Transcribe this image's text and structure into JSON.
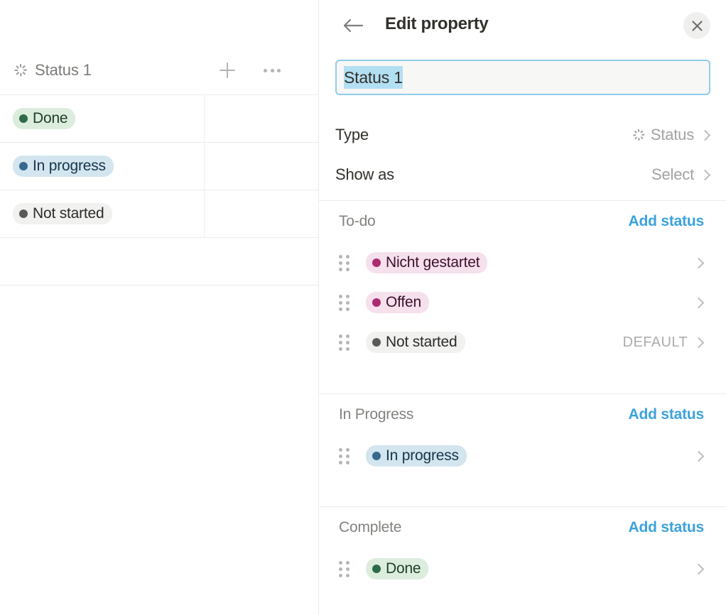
{
  "table": {
    "column": {
      "title": "Status 1",
      "icon": "status-spinner-icon",
      "add_column_icon": "plus-icon",
      "menu_icon": "ellipsis-icon"
    },
    "rows": [
      {
        "label": "Done",
        "bg": "#dcedde",
        "dot": "#2e6b48",
        "fg": "#1d3d2a"
      },
      {
        "label": "In progress",
        "bg": "#d3e5ef",
        "dot": "#37698f",
        "fg": "#17354b"
      },
      {
        "label": "Not started",
        "bg": "#f1f1ef",
        "dot": "#5a5a57",
        "fg": "#2b2b29"
      }
    ],
    "empty_row": ""
  },
  "panel": {
    "title": "Edit property",
    "back_icon": "arrow-left-icon",
    "close_icon": "close-icon",
    "name_value": "Status 1",
    "options": [
      {
        "label": "Type",
        "value": "Status",
        "has_icon": true
      },
      {
        "label": "Show as",
        "value": "Select",
        "has_icon": false
      }
    ],
    "add_status_label": "Add status",
    "default_tag": "DEFAULT",
    "groups": [
      {
        "name": "To-do",
        "statuses": [
          {
            "label": "Nicht gestartet",
            "bg": "#f5e0ec",
            "dot": "#ad2a72",
            "fg": "#3d1029",
            "default": false
          },
          {
            "label": "Offen",
            "bg": "#f5e0ec",
            "dot": "#ad2a72",
            "fg": "#3d1029",
            "default": false
          },
          {
            "label": "Not started",
            "bg": "#f1f1ef",
            "dot": "#5a5a57",
            "fg": "#2b2b29",
            "default": true
          }
        ]
      },
      {
        "name": "In Progress",
        "statuses": [
          {
            "label": "In progress",
            "bg": "#d3e5ef",
            "dot": "#37698f",
            "fg": "#17354b",
            "default": false
          }
        ]
      },
      {
        "name": "Complete",
        "statuses": [
          {
            "label": "Done",
            "bg": "#dcedde",
            "dot": "#2e6b48",
            "fg": "#1d3d2a",
            "default": false
          }
        ]
      }
    ]
  },
  "colors": {
    "accent_link": "#3ba2de",
    "input_border": "#8fcdeb",
    "selection": "#b3dff2",
    "divider": "#ebebea"
  }
}
